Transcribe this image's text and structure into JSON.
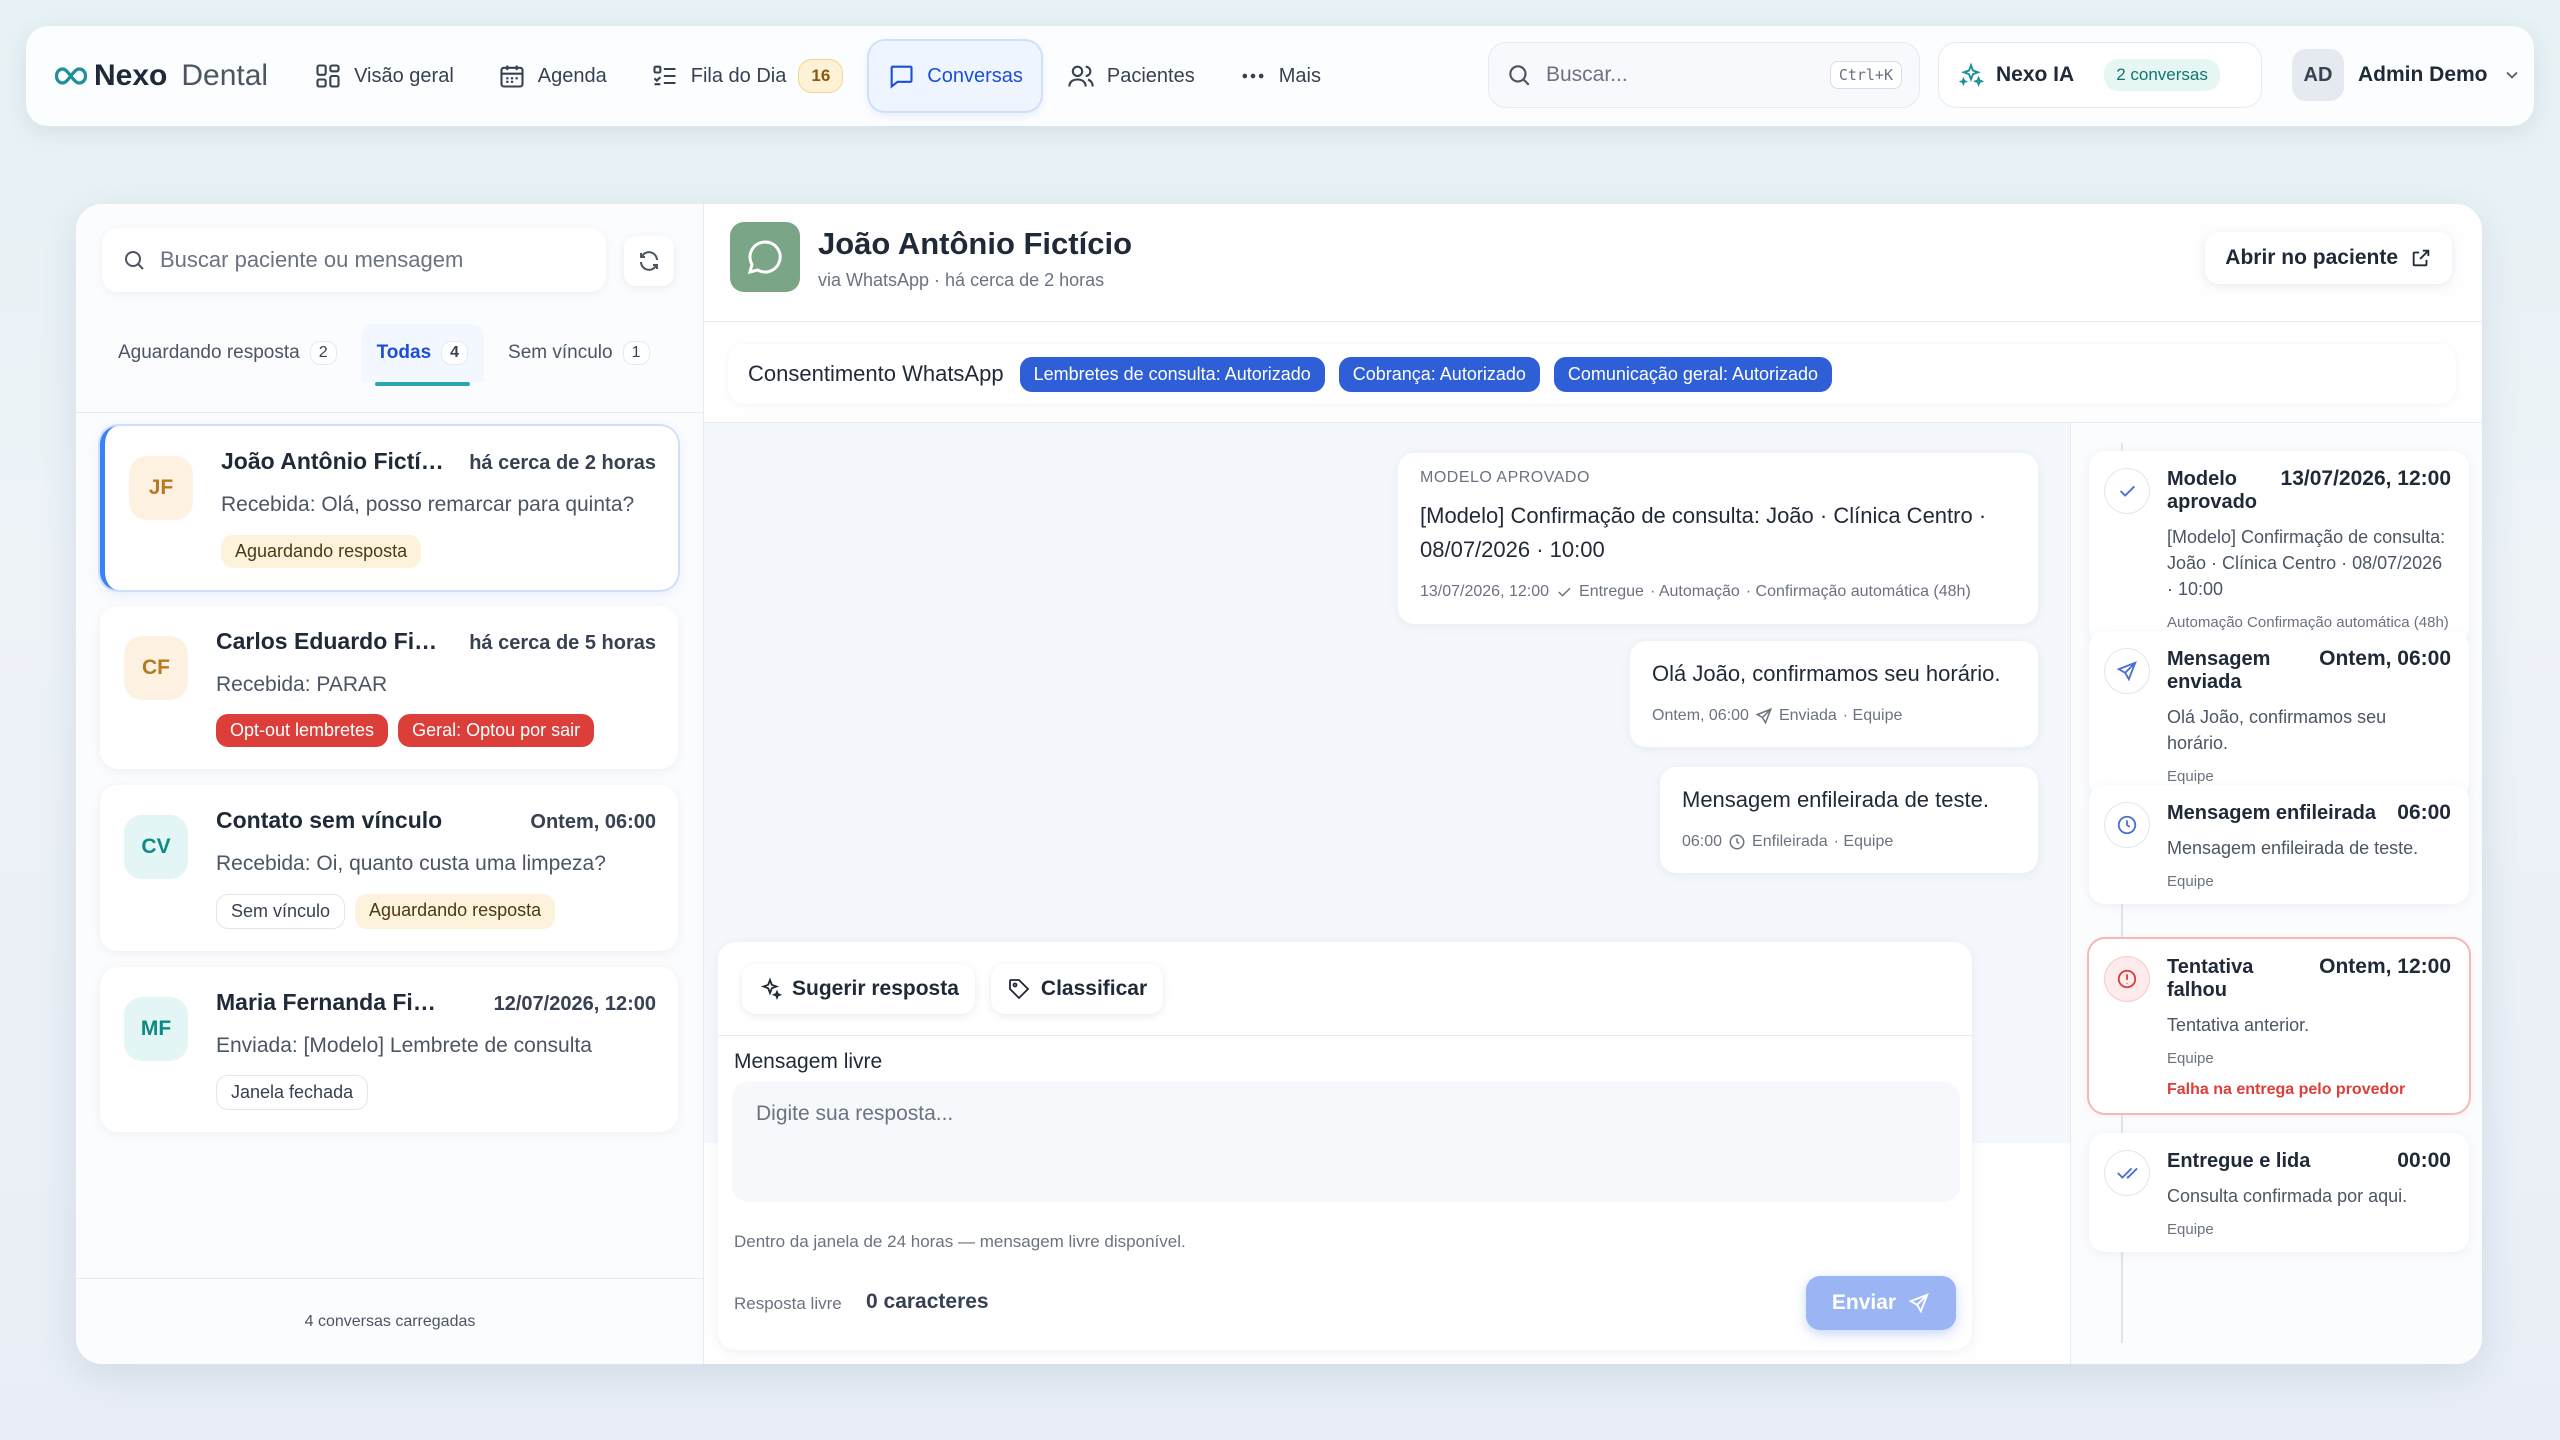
{
  "nav": {
    "brand_a": "Nexo",
    "brand_b": "Dental",
    "items": [
      {
        "label": "Visão geral"
      },
      {
        "label": "Agenda"
      },
      {
        "label": "Fila do Dia",
        "badge": "16"
      },
      {
        "label": "Conversas"
      },
      {
        "label": "Pacientes"
      },
      {
        "label": "Mais"
      }
    ],
    "search_placeholder": "Buscar...",
    "search_shortcut": "Ctrl+K",
    "ia_label": "Nexo IA",
    "ia_badge": "2 conversas",
    "user_initials": "AD",
    "user_name": "Admin Demo"
  },
  "left": {
    "search_placeholder": "Buscar paciente ou mensagem",
    "tabs": [
      {
        "label": "Aguardando resposta",
        "count": "2"
      },
      {
        "label": "Todas",
        "count": "4"
      },
      {
        "label": "Sem vínculo",
        "count": "1"
      }
    ],
    "conversations": [
      {
        "initials": "JF",
        "name": "João Antônio Fictício",
        "time": "há cerca de 2 horas",
        "preview": "Recebida: Olá, posso remarcar para quinta?",
        "chips": [
          "Aguardando resposta"
        ]
      },
      {
        "initials": "CF",
        "name": "Carlos Eduardo Fictício",
        "time": "há cerca de 5 horas",
        "preview": "Recebida: PARAR",
        "chips": [
          "Opt-out lembretes",
          "Geral: Optou por sair"
        ]
      },
      {
        "initials": "CV",
        "name": "Contato sem vínculo",
        "time": "Ontem, 06:00",
        "preview": "Recebida: Oi, quanto custa uma limpeza?",
        "chips": [
          "Sem vínculo",
          "Aguardando resposta"
        ]
      },
      {
        "initials": "MF",
        "name": "Maria Fernanda Fictícia",
        "time": "12/07/2026, 12:00",
        "preview": "Enviada: [Modelo] Lembrete de consulta",
        "chips": [
          "Janela fechada"
        ]
      }
    ],
    "footer": "4 conversas carregadas"
  },
  "chat": {
    "name": "João Antônio Fictício",
    "sub": "via WhatsApp · há cerca de 2 horas",
    "open_label": "Abrir no paciente",
    "consent_label": "Consentimento WhatsApp",
    "consents": [
      "Lembretes de consulta: Autorizado",
      "Cobrança: Autorizado",
      "Comunicação geral: Autorizado"
    ],
    "messages": [
      {
        "kicker": "MODELO APROVADO",
        "body": "[Modelo] Confirmação de consulta: João · Clínica Centro · 08/07/2026 · 10:00",
        "time": "13/07/2026, 12:00",
        "status": "Entregue",
        "source": "· Automação",
        "extra": "· Confirmação automática (48h)"
      },
      {
        "body": "Olá João, confirmamos seu horário.",
        "time": "Ontem, 06:00",
        "status": "Enviada",
        "source": "· Equipe"
      },
      {
        "body": "Mensagem enfileirada de teste.",
        "time": "06:00",
        "status": "Enfileirada",
        "source": "· Equipe"
      }
    ],
    "suggest_label": "Sugerir resposta",
    "classify_label": "Classificar",
    "composer_label": "Mensagem livre",
    "composer_placeholder": "Digite sua resposta...",
    "composer_hint": "Dentro da janela de 24 horas — mensagem livre disponível.",
    "foot_label": "Resposta livre",
    "char_count": "0 caracteres",
    "send_label": "Enviar"
  },
  "timeline": [
    {
      "title": "Modelo aprovado",
      "time": "13/07/2026, 12:00",
      "body": "[Modelo] Confirmação de consulta: João · Clínica Centro · 08/07/2026 · 10:00",
      "meta": "Automação  Confirmação automática (48h)"
    },
    {
      "title": "Mensagem enviada",
      "time": "Ontem, 06:00",
      "body": "Olá João, confirmamos seu horário.",
      "meta": "Equipe"
    },
    {
      "title": "Mensagem enfileirada",
      "time": "06:00",
      "body": "Mensagem enfileirada de teste.",
      "meta": "Equipe"
    },
    {
      "title": "Tentativa falhou",
      "time": "Ontem, 12:00",
      "body": "Tentativa anterior.",
      "meta": "Equipe",
      "error": "Falha na entrega pelo provedor"
    },
    {
      "title": "Entregue e lida",
      "time": "00:00",
      "body": "Consulta confirmada por aqui.",
      "meta": "Equipe"
    }
  ],
  "colors": {
    "accent": "#2f5fd6",
    "teal": "#2aa8b0",
    "danger": "#dc3f3a",
    "wait": "#fdf2dc"
  }
}
